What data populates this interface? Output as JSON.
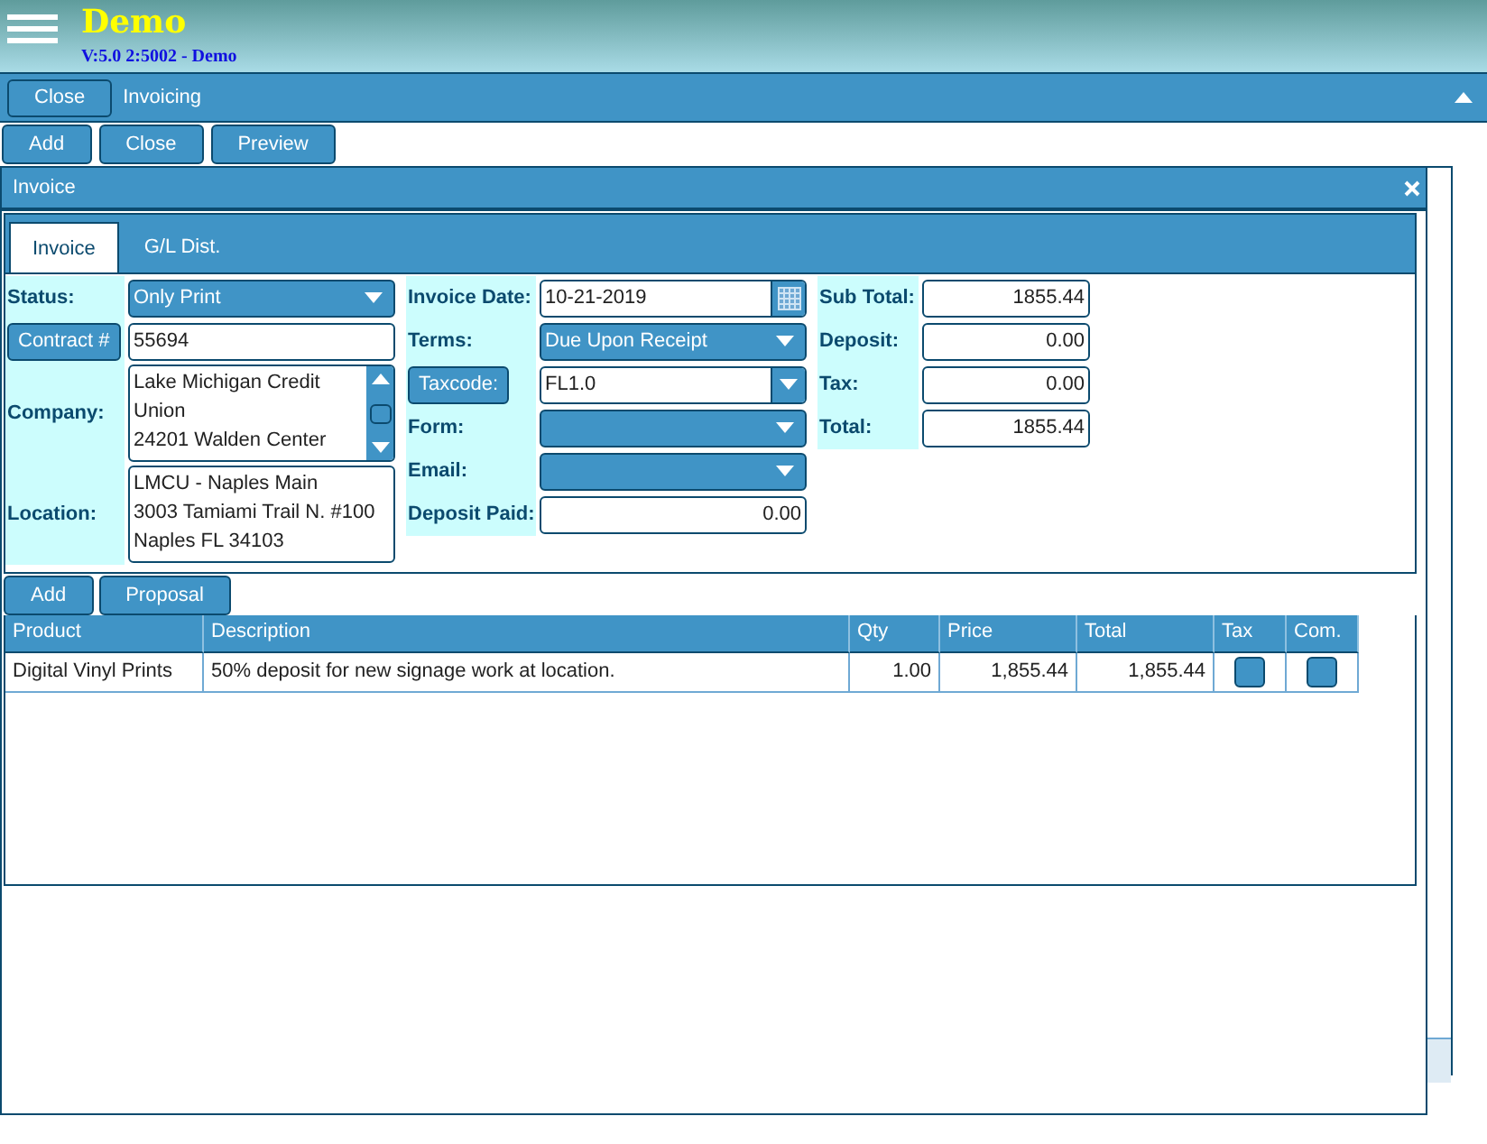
{
  "header": {
    "title": "Demo",
    "subtitle": "V:5.0 2:5002 - Demo"
  },
  "module_bar": {
    "close_button": "Close",
    "title": "Invoicing"
  },
  "toolbar": [
    "Add",
    "Close",
    "Preview"
  ],
  "dialog": {
    "title": "Invoice",
    "tabs": [
      {
        "label": "Invoice",
        "selected": true
      },
      {
        "label": "G/L Dist.",
        "selected": false
      }
    ],
    "form_columns": [
      [
        {
          "label": {
            "kind": "text",
            "text": "Status:"
          },
          "kind": "dropdown",
          "value": "Only Print"
        },
        {
          "label": {
            "kind": "button",
            "text": "Contract #"
          },
          "kind": "text",
          "value": "55694"
        },
        {
          "label": {
            "kind": "text",
            "text": "Company:"
          },
          "kind": "textarea",
          "lines": [
            "Lake Michigan Credit",
            "Union",
            "24201 Walden Center"
          ],
          "scrollbar": true
        },
        {
          "label": {
            "kind": "text",
            "text": "Location:"
          },
          "kind": "textarea",
          "lines": [
            "LMCU - Naples Main",
            "3003 Tamiami Trail N. #100",
            "Naples FL 34103"
          ],
          "scrollbar": false
        }
      ],
      [
        {
          "label": {
            "kind": "text",
            "text": "Invoice Date:"
          },
          "kind": "date",
          "value": "10-21-2019"
        },
        {
          "label": {
            "kind": "text",
            "text": "Terms:"
          },
          "kind": "dropdown",
          "value": "Due Upon Receipt"
        },
        {
          "label": {
            "kind": "button",
            "text": "Taxcode:"
          },
          "kind": "combo",
          "value": "FL1.0"
        },
        {
          "label": {
            "kind": "text",
            "text": "Form:"
          },
          "kind": "dropdown"
        },
        {
          "label": {
            "kind": "text",
            "text": "Email:"
          },
          "kind": "dropdown"
        },
        {
          "label": {
            "kind": "text",
            "text": "Deposit Paid:"
          },
          "kind": "number",
          "value": "0.00"
        }
      ],
      [
        {
          "label": {
            "kind": "text",
            "text": "Sub Total:"
          },
          "kind": "number",
          "value": "1855.44"
        },
        {
          "label": {
            "kind": "text",
            "text": "Deposit:"
          },
          "kind": "number",
          "value": "0.00"
        },
        {
          "label": {
            "kind": "text",
            "text": "Tax:"
          },
          "kind": "number",
          "value": "0.00"
        },
        {
          "label": {
            "kind": "text",
            "text": "Total:"
          },
          "kind": "number",
          "value": "1855.44"
        }
      ]
    ],
    "line_buttons": [
      "Add",
      "Proposal"
    ],
    "table": {
      "columns": [
        "Product",
        "Description",
        "Qty",
        "Price",
        "Total",
        "Tax",
        "Com."
      ],
      "rows": [
        {
          "product": "Digital Vinyl Prints",
          "description": "50% deposit for new signage work at location.",
          "qty": "1.00",
          "price": "1,855.44",
          "total": "1,855.44",
          "tax": false,
          "com": false
        }
      ]
    }
  }
}
